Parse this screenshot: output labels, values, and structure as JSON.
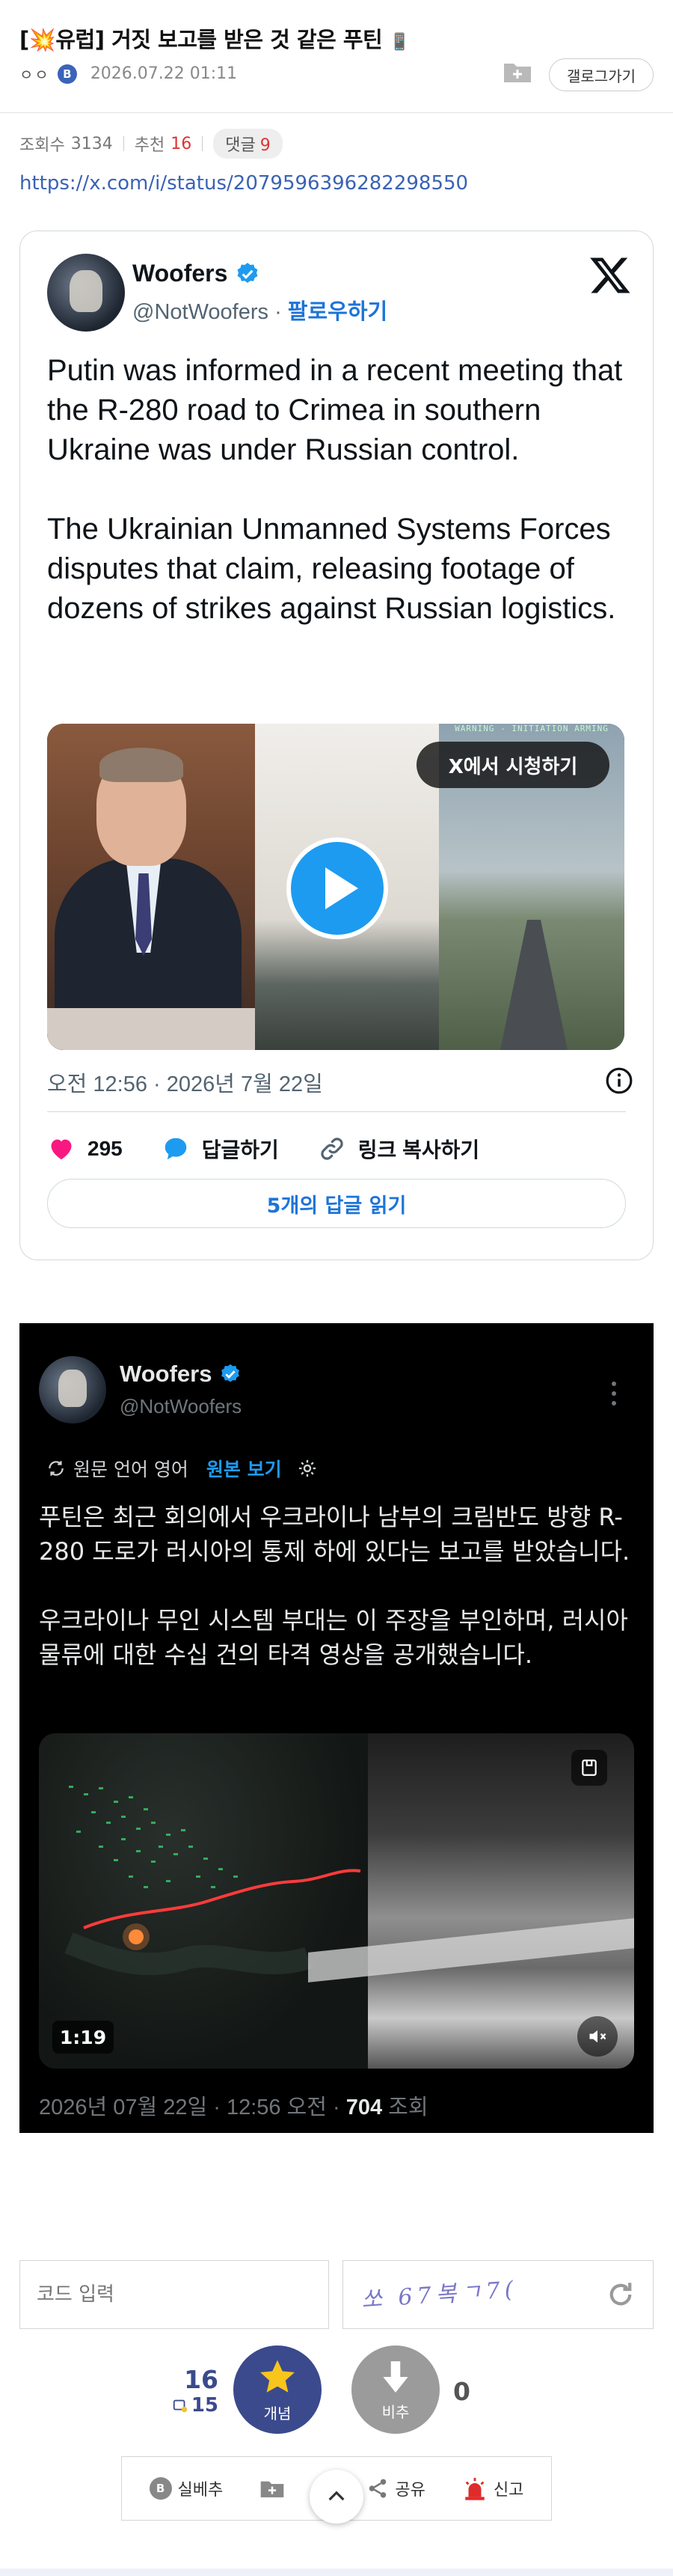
{
  "post": {
    "title_tag": "[💥유럽]",
    "title_text": "거짓 보고를 받은 것 같은 푸틴",
    "title_icon": "📱",
    "author_masked": "ㅇㅇ",
    "author_badge": "B",
    "date": "2026.07.22 01:11",
    "gallery_button": "갤로그가기",
    "views_label": "조회수",
    "views": "3134",
    "upvotes_label": "추천",
    "upvotes": "16",
    "comments_label": "댓글",
    "comments": "9",
    "source_url": "https://x.com/i/status/2079596396282298550"
  },
  "tweet": {
    "name": "Woofers",
    "handle": "@NotWoofers",
    "follow_sep": " · ",
    "follow_label": "팔로우하기",
    "text": "Putin was informed in a recent meeting that the R-280 road to Crimea in southern Ukraine was under Russian control.\n\nThe Ukrainian Unmanned Systems Forces disputes that claim, releasing footage of dozens of strikes against Russian logistics.",
    "media_hud": "WARNING - INITIATION ARMING",
    "watch_label": "X에서 시청하기",
    "timestamp": "오전 12:56 · 2026년 7월 22일",
    "likes": "295",
    "reply_label": "답글하기",
    "copy_link_label": "링크 복사하기",
    "read_replies_label": "5개의 답글 읽기"
  },
  "screenshot": {
    "name": "Woofers",
    "handle": "@NotWoofers",
    "translate_prefix": "원문 언어 영어",
    "translate_link": "원본 보기",
    "text": "푸틴은 최근 회의에서 우크라이나 남부의 크림반도 방향 R-280 도로가 러시아의 통제 하에 있다는 보고를 받았습니다.\n\n우크라이나 무인 시스템 부대는 이 주장을 부인하며, 러시아 물류에 대한 수십 건의 타격 영상을 공개했습니다.",
    "duration": "1:19",
    "footer_date": "2026년 07월 22일 · 12:56 오전 · ",
    "footer_views": "704",
    "footer_views_label": " 조회"
  },
  "captcha": {
    "placeholder": "코드 입력",
    "code_image_text": "쏘 67복ㄱ7("
  },
  "vote": {
    "up_count": "16",
    "fixed_count": "15",
    "up_label": "개념",
    "down_label": "비추",
    "down_count": "0"
  },
  "actions": {
    "report_real": "실베추",
    "share": "공유",
    "report": "신고"
  },
  "colors": {
    "link_blue": "#3a62b4",
    "twitter_blue": "#1d9bf0",
    "vote_blue": "#3b4a8c",
    "accent_red": "#d33333"
  }
}
